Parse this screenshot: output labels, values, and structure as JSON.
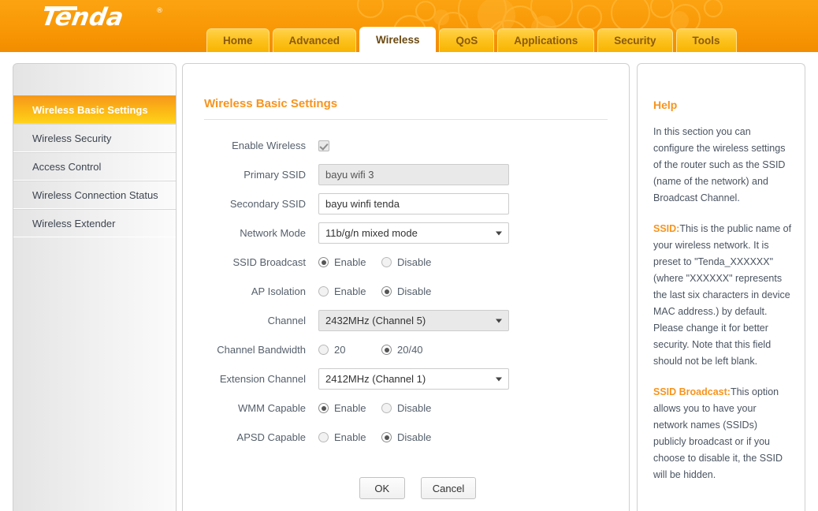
{
  "brand": {
    "logo_text": "Tenda",
    "logo_trademark": "®",
    "header_color": "#f99806",
    "accent_color": "#f7941e"
  },
  "nav": {
    "tabs": [
      {
        "label": "Home",
        "active": false
      },
      {
        "label": "Advanced",
        "active": false
      },
      {
        "label": "Wireless",
        "active": true
      },
      {
        "label": "QoS",
        "active": false
      },
      {
        "label": "Applications",
        "active": false
      },
      {
        "label": "Security",
        "active": false
      },
      {
        "label": "Tools",
        "active": false
      }
    ]
  },
  "sidebar": {
    "items": [
      {
        "label": "Wireless Basic Settings",
        "active": true
      },
      {
        "label": "Wireless Security",
        "active": false
      },
      {
        "label": "Access Control",
        "active": false
      },
      {
        "label": "Wireless Connection Status",
        "active": false
      },
      {
        "label": "Wireless Extender",
        "active": false
      }
    ]
  },
  "main": {
    "title": "Wireless Basic Settings",
    "fields": {
      "enable_wireless": {
        "label": "Enable Wireless",
        "type": "checkbox",
        "checked": true,
        "disabled": true
      },
      "primary_ssid": {
        "label": "Primary SSID",
        "type": "text",
        "value": "bayu wifi 3",
        "placeholder": "",
        "disabled": true
      },
      "secondary_ssid": {
        "label": "Secondary SSID",
        "type": "text",
        "value": "bayu winfi tenda",
        "placeholder": "",
        "disabled": false
      },
      "network_mode": {
        "label": "Network Mode",
        "type": "select",
        "value": "11b/g/n mixed mode",
        "disabled": false
      },
      "ssid_broadcast": {
        "label": "SSID Broadcast",
        "type": "radio",
        "options": [
          "Enable",
          "Disable"
        ],
        "selected": "Enable"
      },
      "ap_isolation": {
        "label": "AP Isolation",
        "type": "radio",
        "options": [
          "Enable",
          "Disable"
        ],
        "selected": "Disable"
      },
      "channel": {
        "label": "Channel",
        "type": "select",
        "value": "2432MHz (Channel 5)",
        "disabled": true
      },
      "channel_bandwidth": {
        "label": "Channel Bandwidth",
        "type": "radio",
        "options": [
          "20",
          "20/40"
        ],
        "selected": "20/40"
      },
      "extension_channel": {
        "label": "Extension Channel",
        "type": "select",
        "value": "2412MHz (Channel 1)",
        "disabled": false
      },
      "wmm_capable": {
        "label": "WMM Capable",
        "type": "radio",
        "options": [
          "Enable",
          "Disable"
        ],
        "selected": "Enable"
      },
      "apsd_capable": {
        "label": "APSD Capable",
        "type": "radio",
        "options": [
          "Enable",
          "Disable"
        ],
        "selected": "Disable"
      }
    },
    "buttons": {
      "ok": "OK",
      "cancel": "Cancel"
    }
  },
  "help": {
    "title": "Help",
    "paragraphs": [
      {
        "term": "",
        "text": "In this section you can configure the wireless settings of the router such as the SSID (name of the network) and Broadcast Channel."
      },
      {
        "term": "SSID:",
        "text": "This is the public name of your wireless network. It is preset to \"Tenda_XXXXXX\" (where \"XXXXXX\" represents the last six characters in device MAC address.) by default. Please change it for better security. Note that this field should not be left blank."
      },
      {
        "term": "SSID Broadcast:",
        "text": "This option allows you to have your network names (SSIDs) publicly broadcast or if you choose to disable it, the SSID will be hidden."
      }
    ]
  }
}
